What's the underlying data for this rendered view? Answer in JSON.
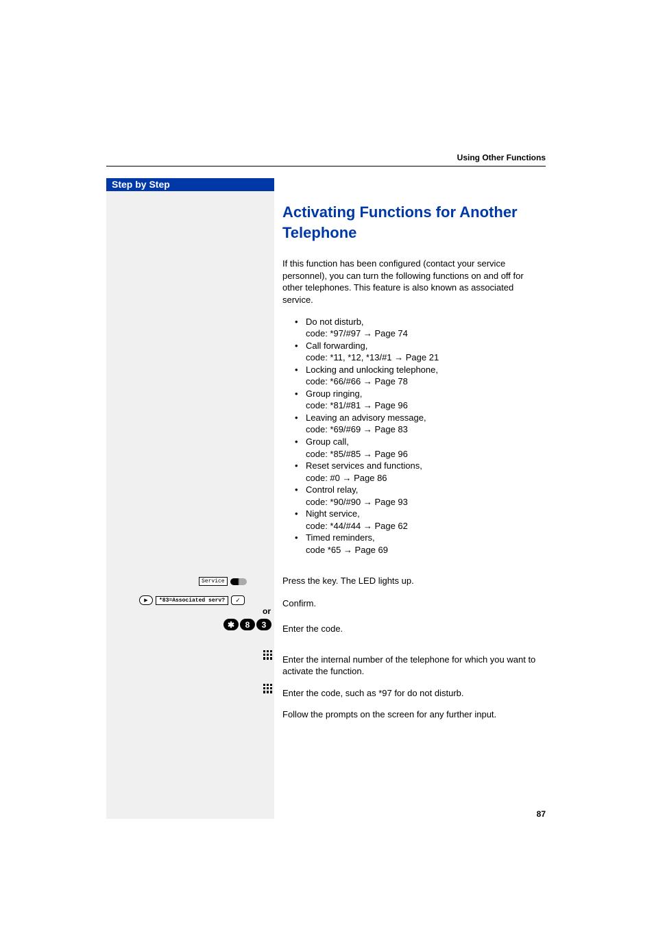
{
  "header": {
    "section": "Using Other Functions"
  },
  "sidebar": {
    "title": "Step by Step"
  },
  "heading": "Activating Functions for Another Telephone",
  "intro": "If this function has been configured (contact your service personnel), you can turn the following functions on and off for other telephones. This feature is also known as associated service.",
  "features": [
    {
      "name": "Do not disturb,",
      "code": "code: *97/#97 → Page 74"
    },
    {
      "name": "Call forwarding,",
      "code": "code: *11, *12, *13/#1 → Page 21"
    },
    {
      "name": "Locking and unlocking telephone,",
      "code": "code: *66/#66 → Page 78"
    },
    {
      "name": "Group ringing,",
      "code": "code: *81/#81 → Page 96"
    },
    {
      "name": "Leaving an advisory message,",
      "code": "code: *69/#69 → Page 83"
    },
    {
      "name": "Group call,",
      "code": "code: *85/#85 → Page 96"
    },
    {
      "name": "Reset services and functions,",
      "code": "code: #0 → Page 86"
    },
    {
      "name": "Control relay,",
      "code": "code: *90/#90 → Page 93"
    },
    {
      "name": "Night service,",
      "code": "code: *44/#44 → Page 62"
    },
    {
      "name": "Timed reminders,",
      "code": "code *65 → Page 69"
    }
  ],
  "widgets": {
    "service_key_label": "Service",
    "assoc_label": "*83=Associated serv?",
    "or_label": "or",
    "code_keys": [
      "✱",
      "8",
      "3"
    ]
  },
  "steps": {
    "press_key": "Press the key. The LED lights up.",
    "confirm": "Confirm.",
    "enter_code": "Enter the code.",
    "enter_internal": "Enter the internal number of the telephone for which you want to activate the function.",
    "enter_feature_code": "Enter the code, such as *97 for do not disturb.",
    "follow_prompts": "Follow the prompts on the screen for any further input."
  },
  "page_number": "87"
}
